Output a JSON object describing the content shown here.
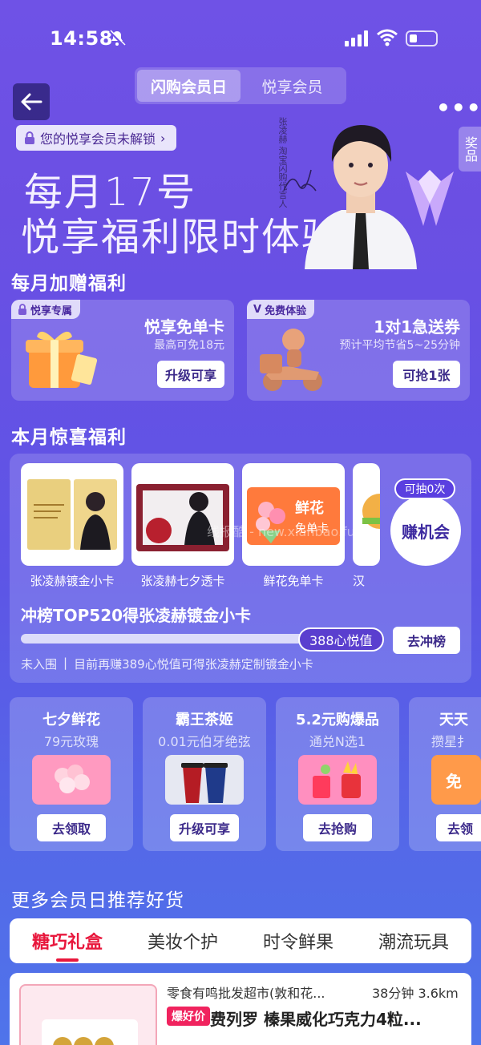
{
  "status_bar": {
    "time": "14:58"
  },
  "header": {
    "tabs": [
      {
        "label": "闪购会员日",
        "active": true
      },
      {
        "label": "悦享会员",
        "active": false
      }
    ],
    "more": "•••",
    "side_tab": "奖品"
  },
  "hero": {
    "unlock_text": "您的悦享会员未解锁",
    "title_line1": "每月17号",
    "title_line2": "悦享福利限时体验",
    "caption": "张凌赫 淘宝闪购代言人"
  },
  "monthly": {
    "section_title": "每月加赠福利",
    "cards": [
      {
        "tag": "悦享专属",
        "title": "悦享免单卡",
        "subtitle": "最高可免18元",
        "button": "升级可享"
      },
      {
        "tag": "免费体验",
        "title": "1对1急送券",
        "subtitle": "预计平均节省5~25分钟",
        "button": "可抢1张"
      }
    ]
  },
  "surprise": {
    "section_title": "本月惊喜福利",
    "prizes": [
      {
        "label": "张凌赫镀金小卡"
      },
      {
        "label": "张凌赫七夕透卡"
      },
      {
        "label": "鲜花免单卡",
        "image_text": "鲜花\n免单卡"
      },
      {
        "label": "汉"
      }
    ],
    "earn_badge": "可抽0次",
    "earn_label": "赚机会",
    "rank_title": "冲榜TOP520得张凌赫镀金小卡",
    "progress_value": "388心悦值",
    "progress_fraction": 0.7,
    "rank_button": "去冲榜",
    "rank_status": "未入围",
    "rank_hint": "目前再赚389心悦值可得张凌赫定制镀金小卡",
    "watermark": "线报酷 - new.xianbao.fun"
  },
  "activities": [
    {
      "title": "七夕鲜花",
      "subtitle": "79元玫瑰",
      "button": "去领取"
    },
    {
      "title": "霸王茶姬",
      "subtitle": "0.01元伯牙绝弦",
      "button": "升级可享"
    },
    {
      "title": "5.2元购爆品",
      "subtitle": "通兑N选1",
      "button": "去抢购"
    },
    {
      "title": "天天",
      "subtitle": "攒星扌",
      "button": "去领"
    }
  ],
  "recommend": {
    "section_title": "更多会员日推荐好货",
    "categories": [
      {
        "label": "糖巧礼盒",
        "active": true
      },
      {
        "label": "美妆个护",
        "active": false
      },
      {
        "label": "时令鲜果",
        "active": false
      },
      {
        "label": "潮流玩具",
        "active": false
      }
    ],
    "product": {
      "store": "零食有鸣批发超市(敦和花...",
      "distance": "38分钟 3.6km",
      "tag": "爆好价",
      "name": "费列罗 榛果威化巧克力4粒..."
    }
  },
  "colors": {
    "accent": "#6f52e6",
    "red": "#e8173c",
    "pill_text": "#4b2a94"
  }
}
